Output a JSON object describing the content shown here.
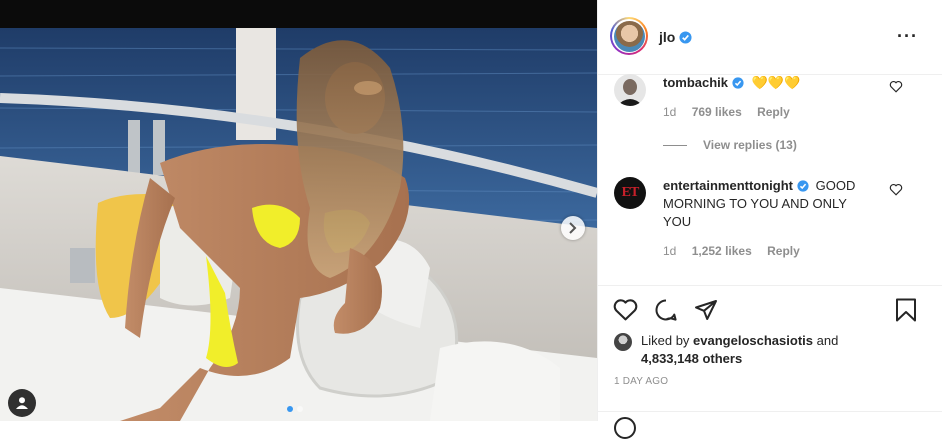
{
  "post": {
    "image_alt": "Woman in yellow bikini sitting on a yacht deck by the sea",
    "carousel": {
      "count": 2,
      "active_index": 0
    }
  },
  "header": {
    "username": "jlo",
    "verified": true
  },
  "comments": [
    {
      "username": "tombachik",
      "verified": true,
      "text": "💛💛💛",
      "time": "1d",
      "likes": "769 likes",
      "reply_label": "Reply",
      "view_replies": "View replies (13)"
    },
    {
      "username": "entertainmenttonight",
      "avatar_text": "ET",
      "verified": true,
      "text": "GOOD MORNING TO YOU AND ONLY YOU",
      "time": "1d",
      "likes": "1,252 likes",
      "reply_label": "Reply"
    }
  ],
  "likes": {
    "prefix": "Liked by",
    "user": "evangeloschasiotis",
    "and": "and",
    "count": "4,833,148 others"
  },
  "timestamp": "1 DAY AGO",
  "colors": {
    "verified": "#3897f0",
    "text": "#262626",
    "muted": "#8e8e8e",
    "et_red": "#b31b1b"
  }
}
